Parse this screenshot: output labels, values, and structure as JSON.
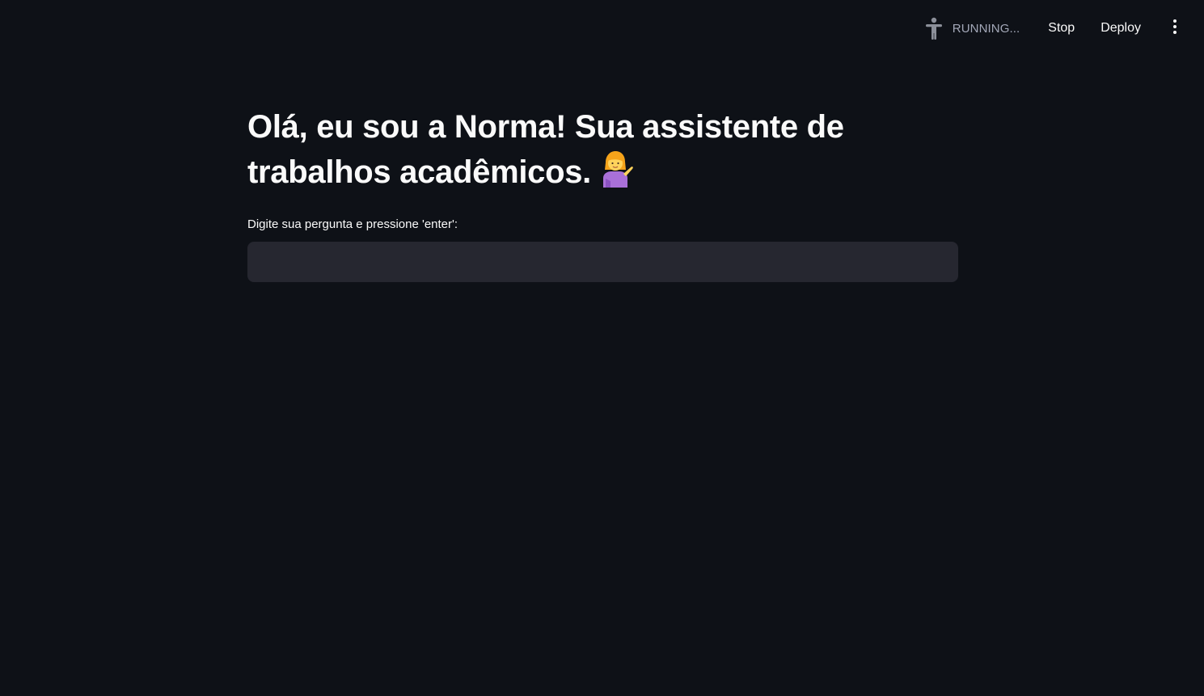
{
  "header": {
    "status_text": "RUNNING...",
    "status_icon": "running-person-icon",
    "stop_label": "Stop",
    "deploy_label": "Deploy",
    "menu_icon": "vertical-dots-icon"
  },
  "main": {
    "title": "Olá, eu sou a Norma! Sua assistente de trabalhos acadêmicos.",
    "title_emoji": "woman-tipping-hand-emoji",
    "input_label": "Digite sua pergunta e pressione 'enter':",
    "input_value": "",
    "input_placeholder": ""
  },
  "colors": {
    "background": "#0e1117",
    "input_background": "#262730",
    "text": "#fafafa",
    "muted_text": "#a3a8b8"
  }
}
